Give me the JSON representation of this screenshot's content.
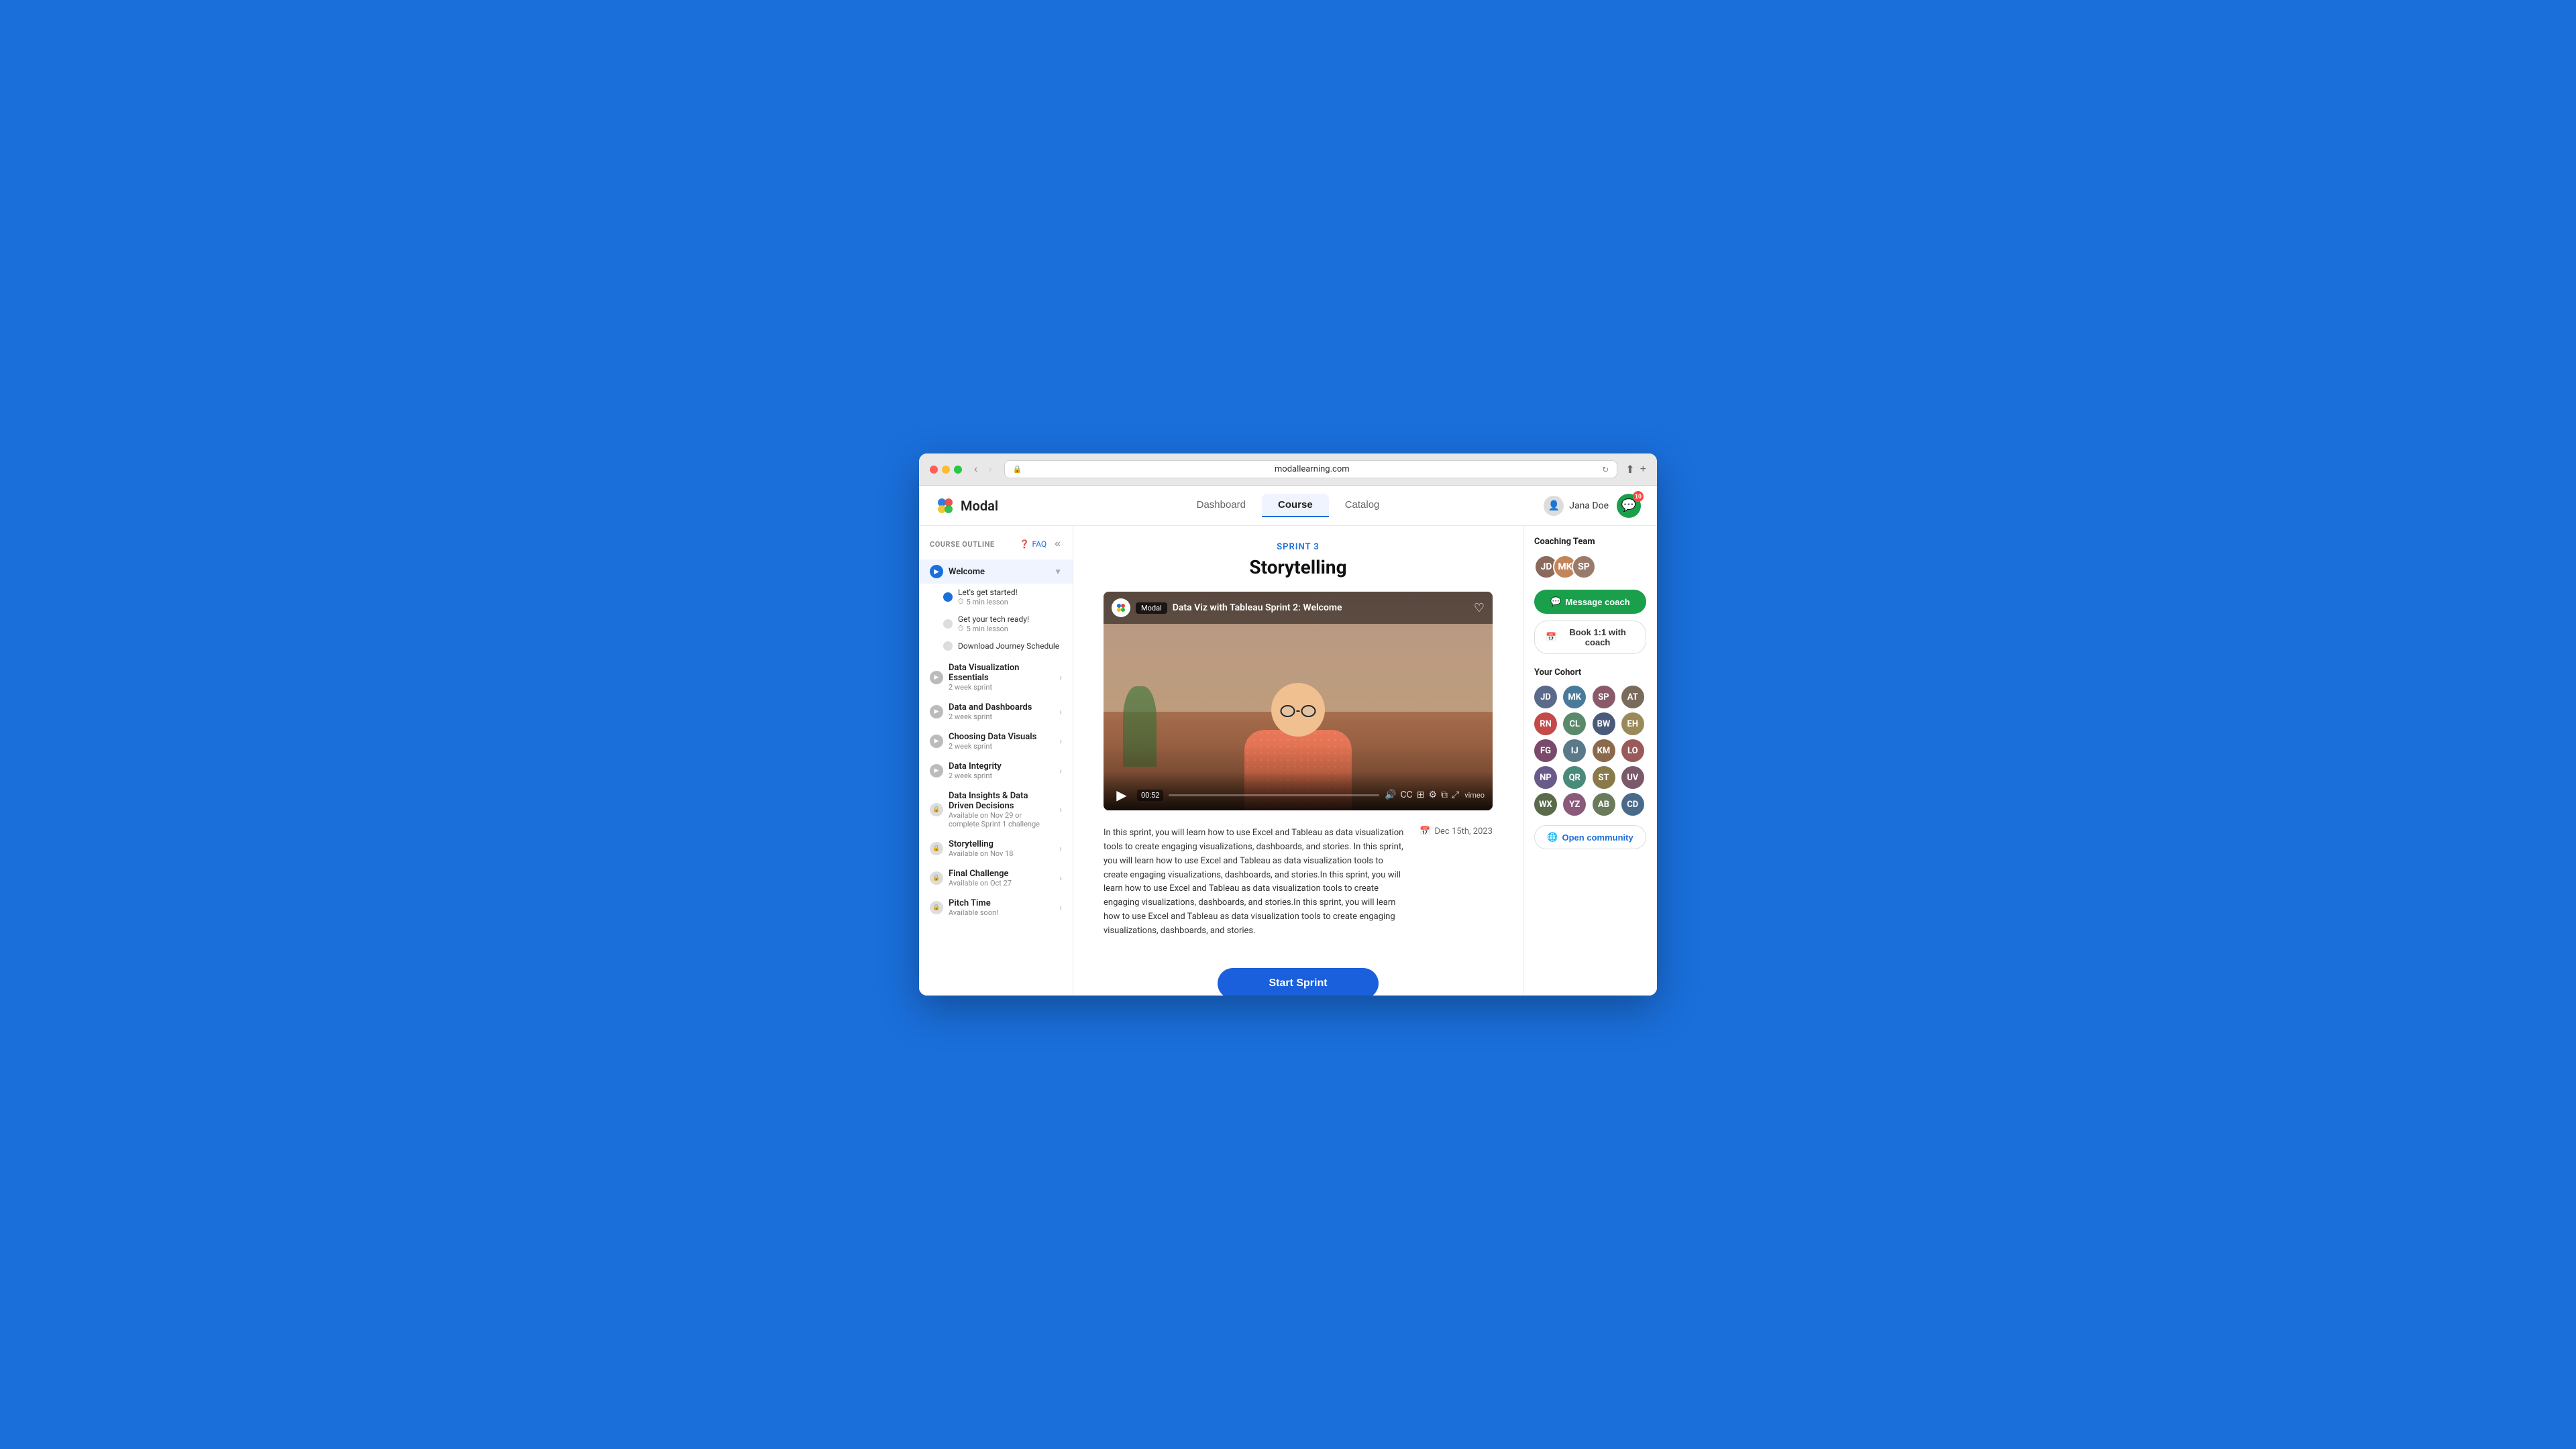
{
  "browser": {
    "url": "modallearning.com",
    "back_disabled": false,
    "forward_disabled": true
  },
  "header": {
    "logo_text": "Modal",
    "nav_items": [
      "Dashboard",
      "Course",
      "Catalog"
    ],
    "active_nav": "Course",
    "user_name": "Jana Doe",
    "message_count": "10"
  },
  "sidebar": {
    "title": "COURSE OUTLINE",
    "faq_label": "FAQ",
    "collapse_label": "«",
    "welcome_section": {
      "title": "Welcome",
      "expanded": true,
      "sub_items": [
        {
          "title": "Let's get started!",
          "time": "5 min lesson",
          "completed": true
        },
        {
          "title": "Get your tech ready!",
          "time": "5 min lesson",
          "completed": false
        },
        {
          "title": "Download Journey Schedule",
          "time": "",
          "completed": false
        }
      ]
    },
    "course_items": [
      {
        "title": "Data Visualization Essentials",
        "subtitle": "2 week sprint",
        "locked": false,
        "has_chevron": true
      },
      {
        "title": "Data and Dashboards",
        "subtitle": "2 week sprint",
        "locked": false,
        "has_chevron": true
      },
      {
        "title": "Choosing Data Visuals",
        "subtitle": "2 week sprint",
        "locked": false,
        "has_chevron": true
      },
      {
        "title": "Data Integrity",
        "subtitle": "2 week sprint",
        "locked": false,
        "has_chevron": true
      },
      {
        "title": "Data Insights & Data Driven Decisions",
        "subtitle": "Available on Nov 29 or complete Sprint 1 challenge",
        "locked": true,
        "has_chevron": true
      },
      {
        "title": "Storytelling",
        "subtitle": "Available on Nov 18",
        "locked": true,
        "has_chevron": true
      },
      {
        "title": "Final Challenge",
        "subtitle": "Available on Oct 27",
        "locked": true,
        "has_chevron": true
      },
      {
        "title": "Pitch Time",
        "subtitle": "Available soon!",
        "locked": true,
        "has_chevron": true
      }
    ]
  },
  "main": {
    "sprint_label": "SPRINT 3",
    "sprint_title": "Storytelling",
    "video": {
      "title": "Data Viz with Tableau Sprint 2: Welcome",
      "platform": "Modal",
      "time": "00:52",
      "heart_icon": "♡"
    },
    "description": "In this sprint, you will learn how to use Excel and Tableau as data visualization tools to create engaging visualizations, dashboards, and stories.\nIn this sprint, you will learn how to use Excel and Tableau as data visualization tools to create engaging visualizations, dashboards, and stories.In this sprint, you will learn how to use Excel and Tableau as data visualization tools to create engaging visualizations, dashboards, and stories.In this sprint, you will learn how to use Excel and Tableau as data visualization tools to create engaging visualizations, dashboards, and stories.",
    "date": "Dec 15th, 2023",
    "start_sprint_label": "Start Sprint"
  },
  "right_panel": {
    "coaching_title": "Coaching Team",
    "message_coach_label": "Message coach",
    "book_label": "Book 1:1 with coach",
    "cohort_title": "Your Cohort",
    "open_community_label": "Open community",
    "coach_colors": [
      "#8a6a5a",
      "#c4845a",
      "#9a7a6a"
    ],
    "cohort_colors": [
      "#5a6a8a",
      "#4a7a9a",
      "#8a5a6a",
      "#7a6a5a",
      "#c44a4a",
      "#5a8a6a",
      "#4a5a7a",
      "#9a8a5a",
      "#7a4a6a",
      "#5a7a8a",
      "#8a6a4a",
      "#9a5a5a",
      "#6a5a8a",
      "#4a8a7a",
      "#8a7a4a",
      "#7a5a6a",
      "#5a6a4a",
      "#8a5a7a",
      "#6a7a5a",
      "#4a6a8a"
    ]
  }
}
